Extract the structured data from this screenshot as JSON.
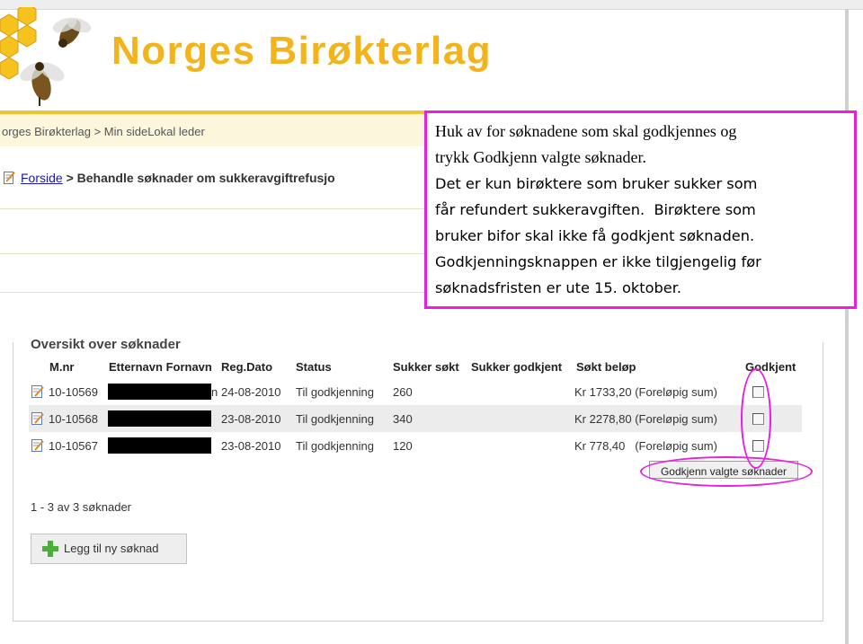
{
  "header": {
    "site_title": "Norges Birøkterlag",
    "breadcrumb": "orges Birøkterlag > Min sideLokal leder"
  },
  "nav": {
    "home_link": "Forside",
    "page_heading": "> Behandle søknader om sukkeravgiftrefusjo"
  },
  "panel": {
    "title": "Oversikt over søknader",
    "columns": [
      "M.nr",
      "Etternavn Fornavn",
      "Reg.Dato",
      "Status",
      "Sukker søkt",
      "Sukker godkjent",
      "Søkt beløp",
      "Godkjent"
    ],
    "rows": [
      {
        "mnr": "10-10569",
        "name_tail": "n",
        "date": "24-08-2010",
        "status": "Til godkjenning",
        "sukker_sokt": "260",
        "belop": "Kr 1733,20 (Foreløpig sum)",
        "godkjent": false
      },
      {
        "mnr": "10-10568",
        "name_tail": "",
        "date": "23-08-2010",
        "status": "Til godkjenning",
        "sukker_sokt": "340",
        "belop": "Kr 2278,80 (Foreløpig sum)",
        "godkjent": false
      },
      {
        "mnr": "10-10567",
        "name_tail": "",
        "date": "23-08-2010",
        "status": "Til godkjenning",
        "sukker_sokt": "120",
        "belop": "Kr 778,40   (Foreløpig sum)",
        "godkjent": false
      }
    ],
    "approve_button": "Godkjenn valgte søknader",
    "count_text": "1 - 3 av 3 søknader",
    "add_button": "Legg til ny søknad"
  },
  "callout": {
    "line1": "Huk av for søknadene som skal godkjennes og",
    "line2": "trykk Godkjenn valgte søknader.",
    "line3": "Det er kun birøktere som bruker sukker som",
    "line4": "får refundert sukkeravgiften.  Birøktere som",
    "line5": "bruker bifor skal ikke få godkjent søknaden.",
    "line6": "Godkjenningsknappen er ikke tilgjengelig før",
    "line7": "søknadsfristen er ute 15. oktober."
  },
  "colors": {
    "logo": "#f3b31b",
    "highlight": "#e91ede",
    "link": "#1a1aa6"
  },
  "icons": [
    "bee-logo-icon",
    "note-icon",
    "edit-icon",
    "plus-icon"
  ]
}
